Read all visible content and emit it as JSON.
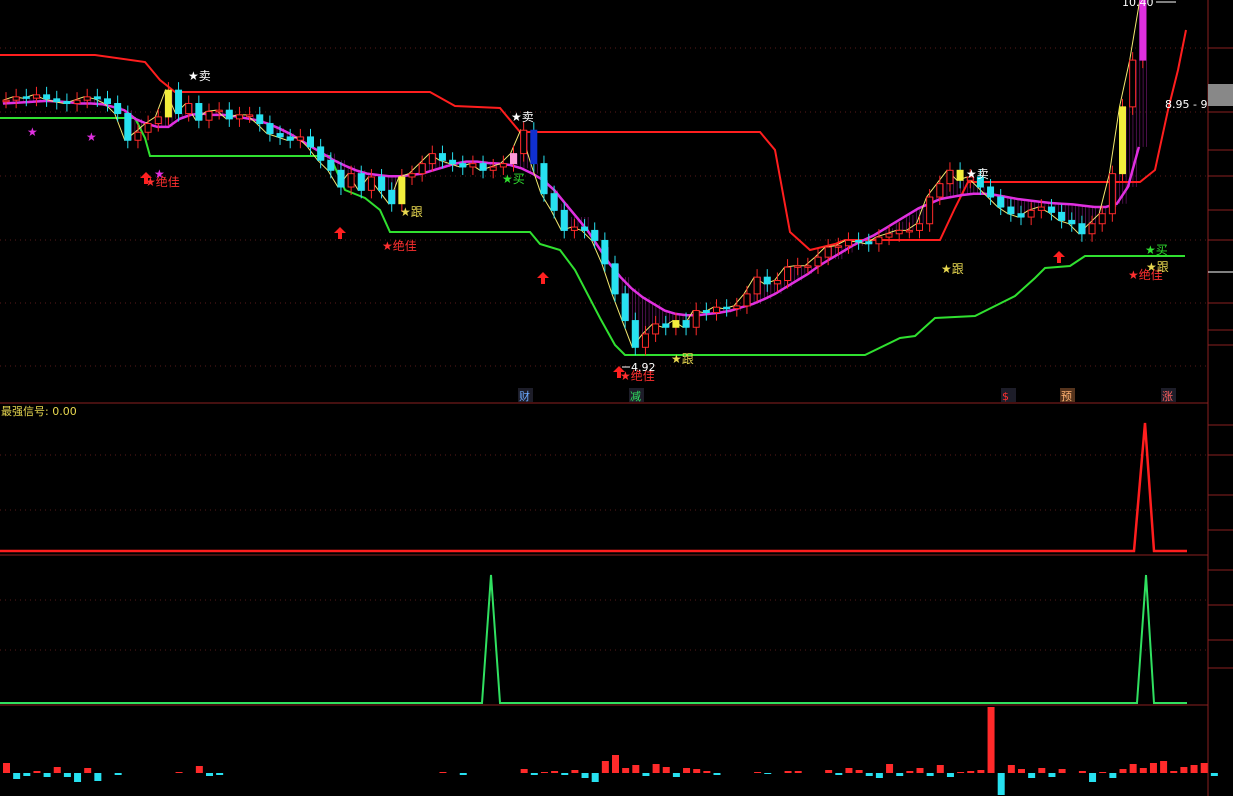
{
  "chart_data": {
    "type": "candlestick",
    "price_labels": {
      "high": "10.40",
      "low": "4.92",
      "range": "8.95 - 9"
    },
    "signal_panel": {
      "title": "最强信号",
      "value": "0.00"
    },
    "annotations": {
      "sell": "★卖",
      "buy": "★买",
      "follow": "★跟",
      "best": "★绝佳"
    },
    "events": [
      {
        "text": "财",
        "color": "#6aa8ff"
      },
      {
        "text": "减",
        "color": "#30e060"
      },
      {
        "text": "$",
        "color": "#ff3030"
      },
      {
        "text": "预",
        "color": "#ffb070"
      },
      {
        "text": "涨",
        "color": "#ff6060"
      }
    ],
    "colors": {
      "up": "#ff2a2a",
      "down": "#27e1f0",
      "ma_magenta": "#e030e0",
      "upper_band": "#ff1e1e",
      "lower_band": "#30e030",
      "signal_red": "#ff1e1e",
      "signal_green": "#30e060"
    },
    "close_path": [
      8.9,
      8.95,
      8.93,
      8.98,
      8.92,
      8.88,
      8.85,
      8.9,
      8.95,
      8.92,
      8.85,
      8.7,
      8.3,
      8.42,
      8.55,
      8.65,
      9.05,
      8.7,
      8.85,
      8.6,
      8.73,
      8.75,
      8.62,
      8.68,
      8.68,
      8.55,
      8.4,
      8.35,
      8.3,
      8.35,
      8.2,
      8.0,
      7.85,
      7.6,
      7.8,
      7.55,
      7.75,
      7.55,
      7.35,
      7.75,
      7.8,
      7.95,
      8.1,
      8.0,
      7.95,
      7.9,
      7.95,
      7.85,
      7.9,
      7.95,
      8.1,
      8.45,
      7.95,
      7.5,
      7.25,
      6.95,
      7.0,
      6.95,
      6.8,
      6.45,
      6.0,
      5.6,
      5.2,
      5.4,
      5.55,
      5.5,
      5.6,
      5.5,
      5.75,
      5.72,
      5.8,
      5.78,
      5.82,
      6.0,
      6.25,
      6.15,
      6.2,
      6.4,
      6.42,
      6.42,
      6.55,
      6.7,
      6.72,
      6.8,
      6.78,
      6.75,
      6.85,
      6.9,
      6.95,
      6.95,
      7.05,
      7.45,
      7.65,
      7.85,
      7.7,
      7.75,
      7.6,
      7.45,
      7.3,
      7.2,
      7.15,
      7.25,
      7.3,
      7.22,
      7.1,
      7.05,
      6.9,
      7.05,
      7.2,
      7.8,
      8.8,
      9.5,
      10.4
    ],
    "ma_path": [
      8.85,
      8.86,
      8.87,
      8.88,
      8.89,
      8.88,
      8.87,
      8.85,
      8.85,
      8.84,
      8.8,
      8.75,
      8.62,
      8.55,
      8.5,
      8.5,
      8.62,
      8.68,
      8.7,
      8.68,
      8.68,
      8.66,
      8.63,
      8.6,
      8.55,
      8.48,
      8.4,
      8.3,
      8.2,
      8.1,
      8.0,
      7.92,
      7.85,
      7.8,
      7.78,
      7.76,
      7.76,
      7.78,
      7.8,
      7.85,
      7.9,
      7.95,
      7.98,
      7.98,
      7.96,
      7.95,
      7.93,
      7.88,
      7.8,
      7.7,
      7.55,
      7.35,
      7.15,
      6.95,
      6.7,
      6.45,
      6.25,
      6.08,
      5.95,
      5.85,
      5.75,
      5.7,
      5.68,
      5.68,
      5.7,
      5.72,
      5.75,
      5.8,
      5.85,
      5.92,
      6.0,
      6.1,
      6.2,
      6.3,
      6.42,
      6.52,
      6.62,
      6.72,
      6.8,
      6.88,
      6.98,
      7.08,
      7.18,
      7.28,
      7.35,
      7.42,
      7.45,
      7.48,
      7.5,
      7.5,
      7.48,
      7.45,
      7.42,
      7.4,
      7.38,
      7.36,
      7.35,
      7.34,
      7.32,
      7.3,
      7.3,
      7.35,
      7.6,
      8.2
    ]
  }
}
